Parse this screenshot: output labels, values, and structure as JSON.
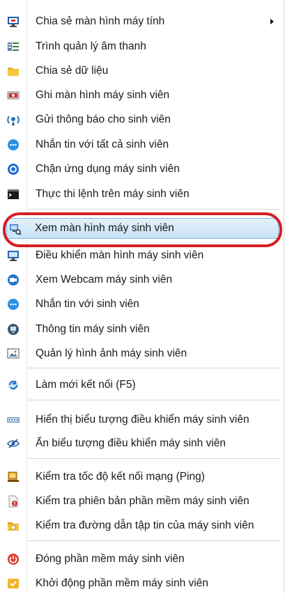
{
  "colors": {
    "highlight_bg": "#cbe5f8",
    "highlight_border": "#7eb4ea",
    "annotation_red": "#d61f26"
  },
  "menu": {
    "items": [
      {
        "label": "Chia sẻ màn hình máy tính",
        "icon": "monitor-share-icon",
        "submenu": true
      },
      {
        "label": "Trình quản lý âm thanh",
        "icon": "audio-manager-icon"
      },
      {
        "label": "Chia sẻ dữ liệu",
        "icon": "folder-icon"
      },
      {
        "label": "Ghi màn hình máy sinh viên",
        "icon": "record-screen-icon"
      },
      {
        "label": "Gửi thông báo cho sinh viên",
        "icon": "broadcast-icon"
      },
      {
        "label": "Nhắn tin với tất cả sinh viên",
        "icon": "chat-bubble-icon"
      },
      {
        "label": "Chặn ứng dụng máy sinh viên",
        "icon": "block-app-icon"
      },
      {
        "label": "Thực thi lệnh trên máy sinh viên",
        "icon": "terminal-icon"
      },
      {
        "label": "Xem màn hình máy sinh viên",
        "icon": "view-screen-icon",
        "highlighted": true
      },
      {
        "label": "Điều khiển màn hình máy sinh viên",
        "icon": "remote-control-icon"
      },
      {
        "label": "Xem Webcam máy sinh viên",
        "icon": "webcam-icon"
      },
      {
        "label": "Nhắn tin với sinh viên",
        "icon": "chat-bubble-icon"
      },
      {
        "label": "Thông tin máy sinh viên",
        "icon": "info-icon"
      },
      {
        "label": "Quản lý hình ảnh máy sinh viên",
        "icon": "image-manager-icon"
      },
      {
        "label": "Làm mới kết nối (F5)",
        "icon": "refresh-icon"
      },
      {
        "label": "Hiển thị biểu tượng điều khiển máy sinh viên",
        "icon": "show-icons-icon"
      },
      {
        "label": "Ẩn biểu tượng điều khiển máy sinh viên",
        "icon": "hide-icons-icon"
      },
      {
        "label": "Kiểm tra tốc độ kết nối mạng (Ping)",
        "icon": "ping-icon"
      },
      {
        "label": "Kiểm tra phiên bản phần mềm máy sinh viên",
        "icon": "version-icon"
      },
      {
        "label": "Kiểm tra đường dẫn tập tin của máy sinh viên",
        "icon": "file-path-icon"
      },
      {
        "label": "Đóng phần mềm máy sinh viên",
        "icon": "power-icon"
      },
      {
        "label": "Khởi động phần mềm máy sinh viên",
        "icon": "start-app-icon"
      }
    ]
  }
}
